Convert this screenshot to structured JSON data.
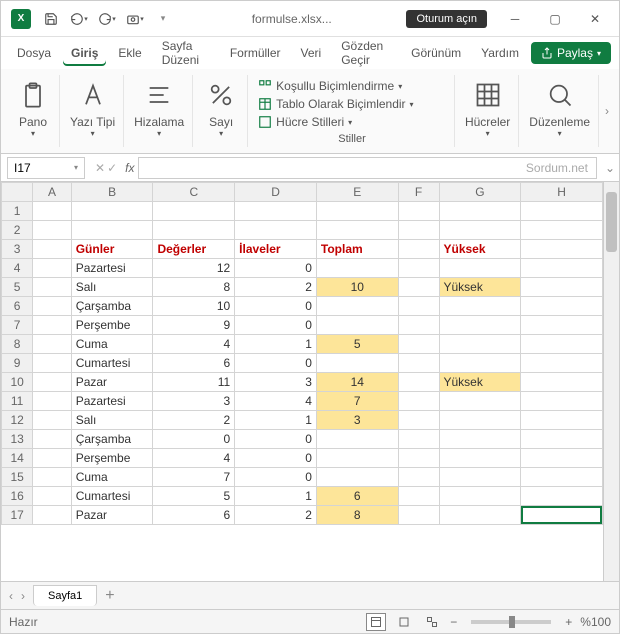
{
  "title": "formulse.xlsx...",
  "login": "Oturum açın",
  "tabs": [
    "Dosya",
    "Giriş",
    "Ekle",
    "Sayfa Düzeni",
    "Formüller",
    "Veri",
    "Gözden Geçir",
    "Görünüm",
    "Yardım"
  ],
  "activeTab": 1,
  "share": "Paylaş",
  "ribbon": {
    "pano": "Pano",
    "yazi": "Yazı Tipi",
    "hizalama": "Hizalama",
    "sayi": "Sayı",
    "stiller": "Stiller",
    "kosullu": "Koşullu Biçimlendirme",
    "tablo": "Tablo Olarak Biçimlendir",
    "hucreStil": "Hücre Stilleri",
    "hucreler": "Hücreler",
    "duzenleme": "Düzenleme"
  },
  "namebox": "I17",
  "watermark": "Sordum.net",
  "chart_data": {
    "type": "table",
    "columns": [
      "A",
      "B",
      "C",
      "D",
      "E",
      "F",
      "G",
      "H"
    ],
    "headers_row": 3,
    "headers": {
      "B": "Günler",
      "C": "Değerler",
      "D": "İlaveler",
      "E": "Toplam",
      "G": "Yüksek"
    },
    "rows": [
      {
        "r": 4,
        "B": "Pazartesi",
        "C": 12,
        "D": 0
      },
      {
        "r": 5,
        "B": "Salı",
        "C": 8,
        "D": 2,
        "E": 10,
        "G": "Yüksek"
      },
      {
        "r": 6,
        "B": "Çarşamba",
        "C": 10,
        "D": 0
      },
      {
        "r": 7,
        "B": "Perşembe",
        "C": 9,
        "D": 0
      },
      {
        "r": 8,
        "B": "Cuma",
        "C": 4,
        "D": 1,
        "E": 5
      },
      {
        "r": 9,
        "B": "Cumartesi",
        "C": 6,
        "D": 0
      },
      {
        "r": 10,
        "B": "Pazar",
        "C": 11,
        "D": 3,
        "E": 14,
        "G": "Yüksek"
      },
      {
        "r": 11,
        "B": "Pazartesi",
        "C": 3,
        "D": 4,
        "E": 7
      },
      {
        "r": 12,
        "B": "Salı",
        "C": 2,
        "D": 1,
        "E": 3
      },
      {
        "r": 13,
        "B": "Çarşamba",
        "C": 0,
        "D": 0
      },
      {
        "r": 14,
        "B": "Perşembe",
        "C": 4,
        "D": 0
      },
      {
        "r": 15,
        "B": "Cuma",
        "C": 7,
        "D": 0
      },
      {
        "r": 16,
        "B": "Cumartesi",
        "C": 5,
        "D": 1,
        "E": 6
      },
      {
        "r": 17,
        "B": "Pazar",
        "C": 6,
        "D": 2,
        "E": 8
      }
    ]
  },
  "sheetTab": "Sayfa1",
  "status": "Hazır",
  "zoom": "%100"
}
